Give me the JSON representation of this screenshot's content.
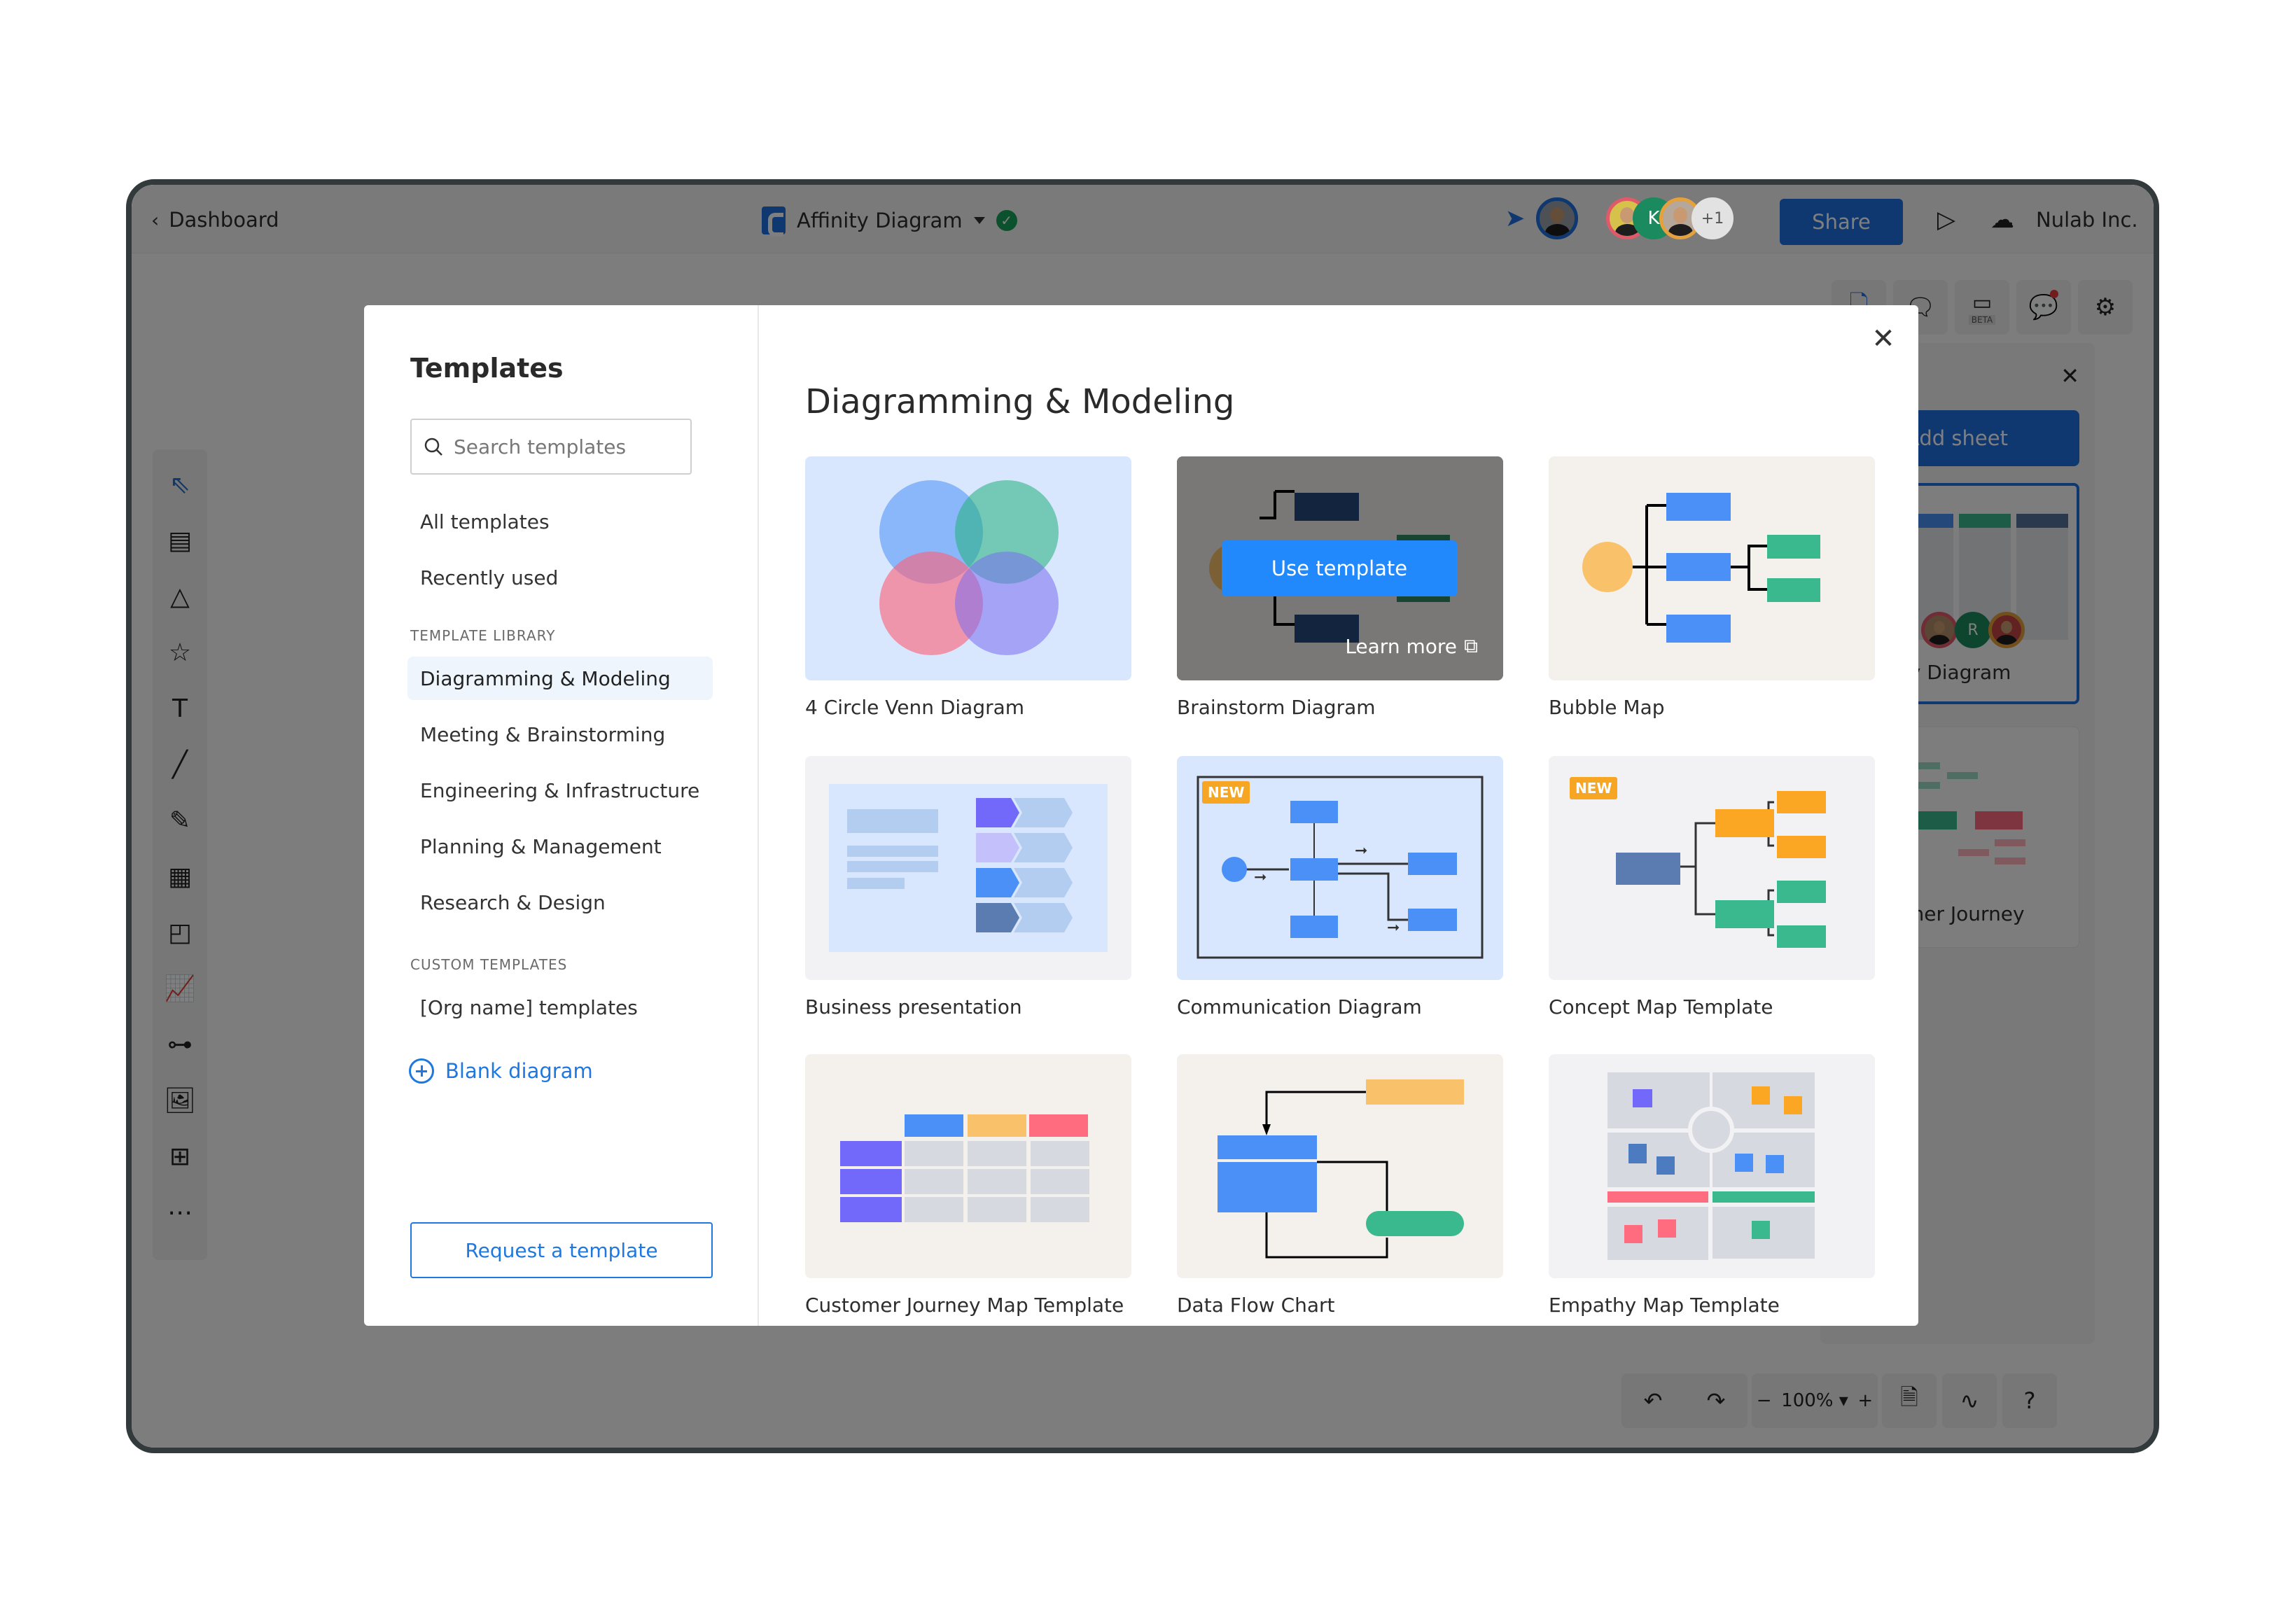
{
  "topbar": {
    "back_label": "Dashboard",
    "doc_title": "Affinity Diagram",
    "saved_status": "saved",
    "collaborators_overflow": "+1",
    "collaborator_initial": "K",
    "share_label": "Share",
    "org_name": "Nulab Inc."
  },
  "right_toolbar": {
    "video_badge": "BETA"
  },
  "left_toolbar": {
    "tools": [
      "select",
      "text-block",
      "shapes",
      "star",
      "text",
      "line",
      "pencil",
      "table",
      "sticky-note",
      "chart",
      "mind-map",
      "image",
      "comment",
      "more"
    ]
  },
  "sheet_panel": {
    "add_sheet_label": "Add sheet",
    "sheets": [
      {
        "name": "Affinity Diagram",
        "visible_fragment": "gram",
        "active": true,
        "avatar_initial": "R"
      },
      {
        "name": "Customer Journey",
        "visible_fragment": "ustomer Journey",
        "active": false
      }
    ]
  },
  "bottom_bar": {
    "zoom_level": "100%"
  },
  "modal": {
    "sidebar_title": "Templates",
    "search_placeholder": "Search templates",
    "search_value": "",
    "nav_top": [
      {
        "label": "All templates"
      },
      {
        "label": "Recently used"
      }
    ],
    "library_label": "TEMPLATE LIBRARY",
    "library": [
      {
        "label": "Diagramming & Modeling",
        "active": true
      },
      {
        "label": "Meeting & Brainstorming"
      },
      {
        "label": "Engineering & Infrastructure"
      },
      {
        "label": "Planning & Management"
      },
      {
        "label": "Research & Design"
      }
    ],
    "custom_label": "CUSTOM TEMPLATES",
    "custom": [
      {
        "label": "[Org name] templates"
      }
    ],
    "blank_diagram_label": "Blank diagram",
    "request_label": "Request a template",
    "heading": "Diagramming & Modeling",
    "use_template_label": "Use template",
    "learn_more_label": "Learn more",
    "new_badge": "NEW",
    "templates": [
      {
        "name": "4 Circle Venn Diagram",
        "thumb": "venn",
        "bg": "#d8e7fd"
      },
      {
        "name": "Brainstorm Diagram",
        "thumb": "brainstorm",
        "bg": "#f4f0ec",
        "hovered": true
      },
      {
        "name": "Bubble Map",
        "thumb": "bubble",
        "bg": "#f4f0ec"
      },
      {
        "name": "Business presentation",
        "thumb": "business",
        "bg": "#f2f2f4"
      },
      {
        "name": "Communication Diagram",
        "thumb": "communication",
        "bg": "#d8e7fd",
        "is_new": true
      },
      {
        "name": "Concept Map Template",
        "thumb": "concept",
        "bg": "#f2f2f4",
        "is_new": true
      },
      {
        "name": "Customer Journey Map Template",
        "thumb": "journey",
        "bg": "#f4f0ec"
      },
      {
        "name": "Data Flow Chart",
        "thumb": "dataflow",
        "bg": "#f4f0ec"
      },
      {
        "name": "Empathy Map Template",
        "thumb": "empathy",
        "bg": "#f2f2f4"
      }
    ]
  },
  "colors": {
    "accent": "#1f6fe0",
    "link": "#1f78e0",
    "use_template": "#2289fc",
    "new_badge": "#f6a623",
    "blue": "#4a90f7",
    "navy": "#26497d",
    "green": "#3bb98e",
    "orange": "#fba724",
    "yellow": "#f8c16a",
    "red": "#ff6b7f",
    "purple": "#7269fb",
    "gray_cell": "#d6d9e0"
  }
}
